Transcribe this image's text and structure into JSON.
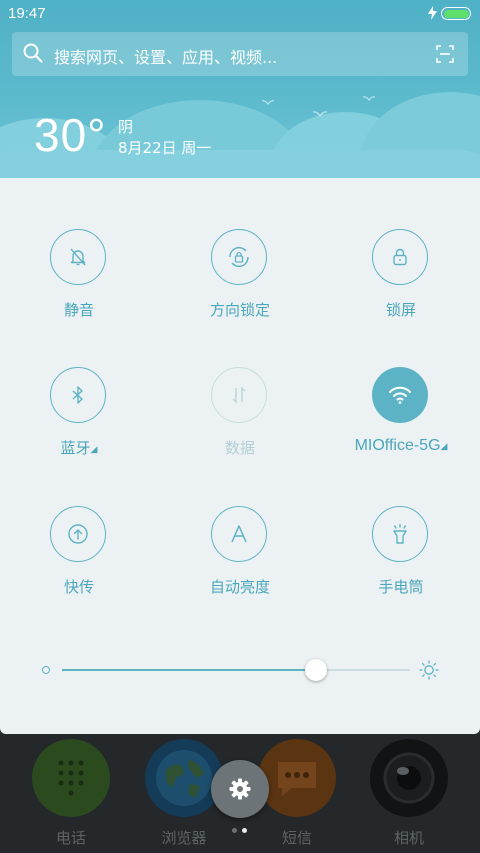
{
  "status_bar": {
    "time": "19:47"
  },
  "search": {
    "placeholder": "搜索网页、设置、应用、视频..."
  },
  "weather": {
    "temperature": "30°",
    "condition": "阴",
    "date": "8月22日 周一"
  },
  "toggles": [
    {
      "label": "静音",
      "icon": "bell-off-icon",
      "state": "off"
    },
    {
      "label": "方向锁定",
      "icon": "rotation-lock-icon",
      "state": "off"
    },
    {
      "label": "锁屏",
      "icon": "lock-icon",
      "state": "off"
    },
    {
      "label": "蓝牙",
      "icon": "bluetooth-icon",
      "state": "off",
      "has_menu": true
    },
    {
      "label": "数据",
      "icon": "mobile-data-icon",
      "state": "disabled"
    },
    {
      "label": "MIOffice-5G",
      "icon": "wifi-icon",
      "state": "on",
      "has_menu": true
    },
    {
      "label": "快传",
      "icon": "share-transfer-icon",
      "state": "off"
    },
    {
      "label": "自动亮度",
      "icon": "auto-brightness-icon",
      "state": "off"
    },
    {
      "label": "手电筒",
      "icon": "flashlight-icon",
      "state": "off"
    }
  ],
  "brightness": {
    "level": 0.73
  },
  "dock": {
    "apps": [
      {
        "label": "电话",
        "icon": "phone-icon"
      },
      {
        "label": "浏览器",
        "icon": "browser-globe-icon"
      },
      {
        "label": "短信",
        "icon": "messages-icon"
      },
      {
        "label": "相机",
        "icon": "camera-icon"
      }
    ]
  },
  "colors": {
    "accent": "#5db3c6",
    "panel_bg": "#ecf2f3",
    "header_bg": "#5cbacd",
    "battery": "#5fe06a"
  }
}
